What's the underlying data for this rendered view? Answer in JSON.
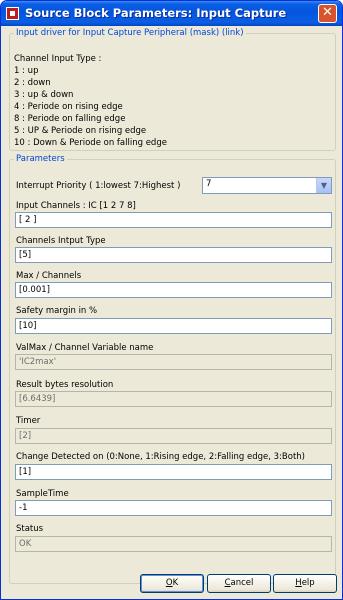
{
  "window": {
    "title": "Source Block Parameters: Input Capture",
    "close_symbol": "✕"
  },
  "description": {
    "legend": "Input driver for Input Capture Peripheral (mask) (link)",
    "lines": [
      "Channel Input Type :",
      "1 : up",
      "2 : down",
      "3 : up & down",
      "4 : Periode on rising edge",
      "8 : Periode on falling edge",
      "5 : UP & Periode on rising edge",
      "10 : Down & Periode on falling edge"
    ]
  },
  "parameters": {
    "legend": "Parameters",
    "interrupt_priority": {
      "label": "Interrupt Priority  ( 1:lowest  7:Highest )",
      "value": "7"
    },
    "fields": [
      {
        "label": "Input Channels : IC [1  2  7  8]",
        "value": "[ 2 ]",
        "readonly": false
      },
      {
        "label": "Channels Intput Type",
        "value": "[5]",
        "readonly": false
      },
      {
        "label": "Max / Channels",
        "value": "[0.001]",
        "readonly": false
      },
      {
        "label": "Safety margin in %",
        "value": "[10]",
        "readonly": false
      },
      {
        "label": "ValMax / Channel Variable name",
        "value": "'IC2max'",
        "readonly": true
      },
      {
        "label": "Result bytes resolution",
        "value": "[6.6439]",
        "readonly": true
      },
      {
        "label": "Timer",
        "value": "[2]",
        "readonly": true
      },
      {
        "label": "Change Detected on   (0:None,  1:Rising edge, 2:Falling edge,  3:Both)",
        "value": "[1]",
        "readonly": false
      },
      {
        "label": "SampleTime",
        "value": "-1",
        "readonly": false
      },
      {
        "label": "Status",
        "value": "OK",
        "readonly": true
      }
    ]
  },
  "buttons": {
    "ok": {
      "first": "O",
      "rest": "K"
    },
    "cancel": {
      "first": "C",
      "rest": "ancel"
    },
    "help": {
      "first": "H",
      "rest": "elp"
    }
  }
}
